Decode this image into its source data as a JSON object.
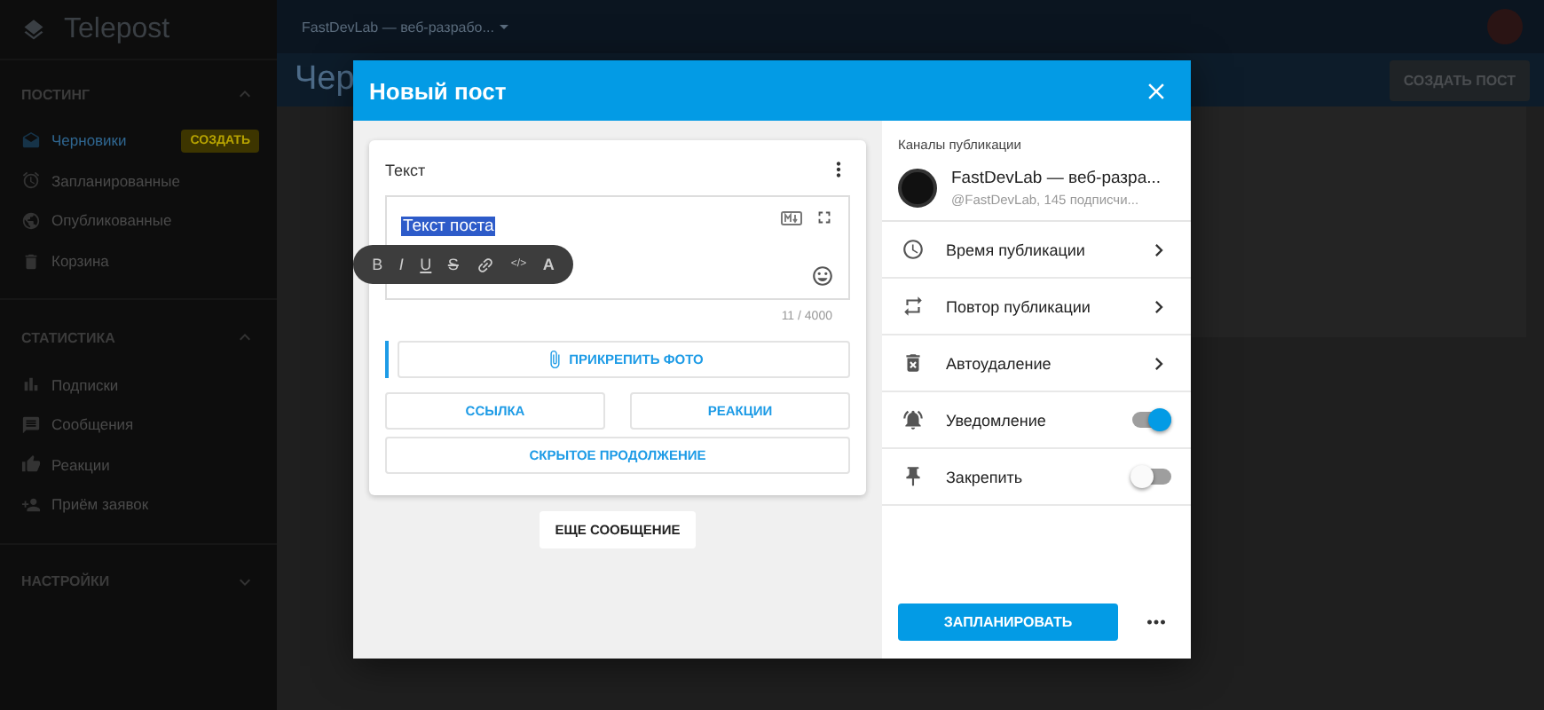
{
  "app": {
    "name": "Telepost",
    "channel_selector": "FastDevLab — веб-разрабо...",
    "page_title": "Чер",
    "create_post_button": "СОЗДАТЬ ПОСТ"
  },
  "sidebar": {
    "sections": [
      {
        "title": "ПОСТИНГ",
        "expanded": true,
        "items": [
          {
            "label": "Черновики",
            "selected": true,
            "badge": "СОЗДАТЬ"
          },
          {
            "label": "Запланированные",
            "selected": false
          },
          {
            "label": "Опубликованные",
            "selected": false
          },
          {
            "label": "Корзина",
            "selected": false
          }
        ]
      },
      {
        "title": "СТАТИСТИКА",
        "expanded": true,
        "items": [
          {
            "label": "Подписки",
            "selected": false
          },
          {
            "label": "Сообщения",
            "selected": false
          },
          {
            "label": "Реакции",
            "selected": false
          },
          {
            "label": "Приём заявок",
            "selected": false
          }
        ]
      },
      {
        "title": "НАСТРОЙКИ",
        "expanded": false
      }
    ]
  },
  "modal": {
    "title": "Новый пост",
    "editor": {
      "label": "Текст",
      "value": "Текст поста",
      "counter": "11 / 4000",
      "format_tools": [
        {
          "kind": "bold",
          "label": "B"
        },
        {
          "kind": "italic",
          "label": "I"
        },
        {
          "kind": "underline",
          "label": "U"
        },
        {
          "kind": "strike",
          "label": "S"
        },
        {
          "kind": "link"
        },
        {
          "kind": "code",
          "label": "</>"
        },
        {
          "kind": "clear",
          "label": "A"
        }
      ],
      "attach_button": "ПРИКРЕПИТЬ ФОТО",
      "buttons": [
        "ССЫЛКА",
        "РЕАКЦИИ"
      ],
      "hidden_button": "СКРЫТОЕ ПРОДОЛЖЕНИЕ"
    },
    "more_message_button": "ЕЩЕ СООБЩЕНИЕ",
    "channels_label": "Каналы публикации",
    "channel": {
      "name": "FastDevLab — веб-разра...",
      "subtitle": "@FastDevLab, 145 подписчи..."
    },
    "options": [
      {
        "kind": "nav",
        "label": "Время публикации"
      },
      {
        "kind": "nav",
        "label": "Повтор публикации"
      },
      {
        "kind": "nav",
        "label": "Автоудаление"
      },
      {
        "kind": "toggle",
        "label": "Уведомление",
        "on": true
      },
      {
        "kind": "toggle",
        "label": "Закрепить",
        "on": false
      }
    ],
    "schedule_button": "ЗАПЛАНИРОВАТЬ"
  }
}
